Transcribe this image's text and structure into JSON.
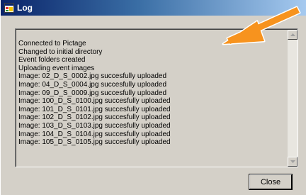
{
  "window": {
    "title": "Log",
    "icon": "app-window-icon"
  },
  "log": {
    "lines": [
      "Connected to Pictage",
      "Changed to initial directory",
      "Event folders created",
      "Uploading event images",
      "Image: 02_D_S_0002.jpg succesfully uploaded",
      "Image: 04_D_S_0004.jpg succesfully uploaded",
      "Image: 09_D_S_0009.jpg succesfully uploaded",
      "Image: 100_D_S_0100.jpg succesfully uploaded",
      "Image: 101_D_S_0101.jpg succesfully uploaded",
      "Image: 102_D_S_0102.jpg succesfully uploaded",
      "Image: 103_D_S_0103.jpg succesfully uploaded",
      "Image: 104_D_S_0104.jpg succesfully uploaded",
      "Image: 105_D_S_0105.jpg succesfully uploaded"
    ]
  },
  "buttons": {
    "close_label": "Close"
  },
  "annotation": {
    "arrow_color": "#f7931e"
  }
}
